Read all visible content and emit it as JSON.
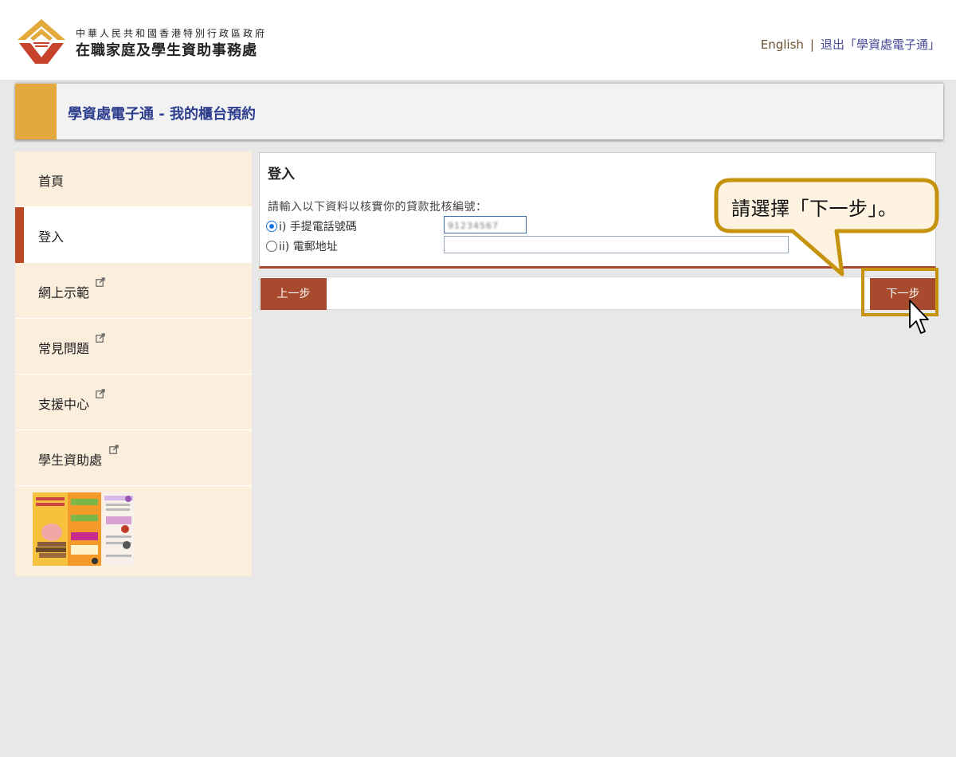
{
  "header": {
    "org_line1": "中華人民共和國香港特別行政區政府",
    "org_line2": "在職家庭及學生資助事務處",
    "lang_link": "English",
    "separator": "|",
    "logout_link": "退出「學資處電子通」"
  },
  "page_title": "學資處電子通 - 我的櫃台預約",
  "sidebar": {
    "items": [
      {
        "label": "首頁",
        "external": false,
        "active": false
      },
      {
        "label": "登入",
        "external": false,
        "active": true
      },
      {
        "label": "網上示範",
        "external": true,
        "active": false
      },
      {
        "label": "常見問題",
        "external": true,
        "active": false
      },
      {
        "label": "支援中心",
        "external": true,
        "active": false
      },
      {
        "label": "學生資助處",
        "external": true,
        "active": false
      }
    ]
  },
  "login": {
    "title": "登入",
    "instruction": "請輸入以下資料以核實你的貸款批核編號：",
    "option_phone_label": "i) 手提電話號碼",
    "option_email_label": "ii) 電郵地址",
    "phone_value": "91234567",
    "selected_option": "phone"
  },
  "buttons": {
    "prev": "上一步",
    "next": "下一步"
  },
  "callout": {
    "text": "請選擇「下一步」。"
  },
  "colors": {
    "accent_orange": "#e3a93c",
    "button_brown": "#a84a2d",
    "title_blue": "#2e3e8e",
    "sidebar_bg": "#fbeedd",
    "highlight_gold": "#c6930f"
  }
}
